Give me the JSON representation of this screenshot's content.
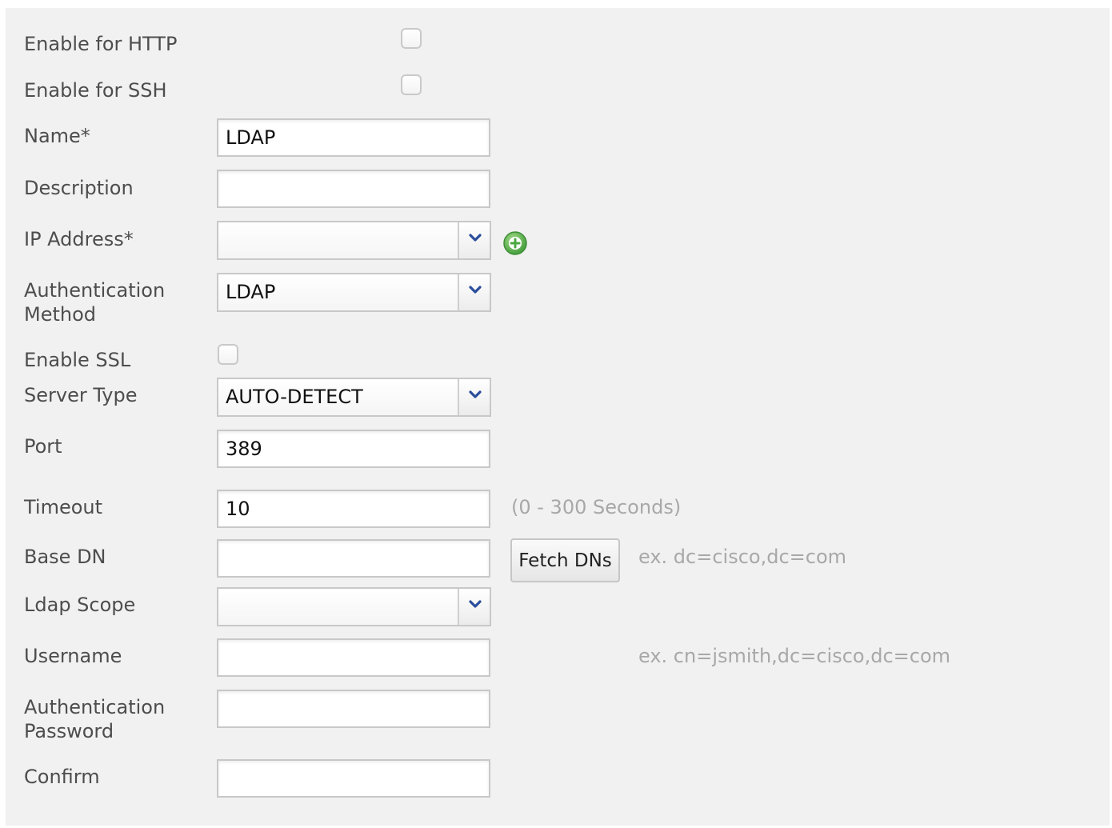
{
  "form": {
    "enable_http": {
      "label": "Enable for HTTP",
      "checked": false
    },
    "enable_ssh": {
      "label": "Enable for SSH",
      "checked": false
    },
    "name": {
      "label": "Name*",
      "value": "LDAP"
    },
    "description": {
      "label": "Description",
      "value": ""
    },
    "ip_address": {
      "label": "IP Address*",
      "value": "",
      "add_icon": "add-circle-icon"
    },
    "auth_method": {
      "label_line1": "Authentication",
      "label_line2": "Method",
      "value": "LDAP"
    },
    "enable_ssl": {
      "label": "Enable SSL",
      "checked": false
    },
    "server_type": {
      "label": "Server Type",
      "value": "AUTO-DETECT"
    },
    "port": {
      "label": "Port",
      "value": "389"
    },
    "timeout": {
      "label": "Timeout",
      "value": "10",
      "hint": "(0 - 300 Seconds)"
    },
    "base_dn": {
      "label": "Base DN",
      "value": "",
      "button": "Fetch DNs",
      "hint": "ex. dc=cisco,dc=com"
    },
    "ldap_scope": {
      "label": "Ldap Scope",
      "value": ""
    },
    "username": {
      "label": "Username",
      "value": "",
      "hint": "ex. cn=jsmith,dc=cisco,dc=com"
    },
    "auth_password": {
      "label_line1": "Authentication",
      "label_line2": "Password",
      "value": ""
    },
    "confirm": {
      "label": "Confirm",
      "value": ""
    }
  },
  "colors": {
    "panel": "#f1f1f1",
    "chevron": "#2a4d9b",
    "add_icon": "#5cb85c"
  }
}
